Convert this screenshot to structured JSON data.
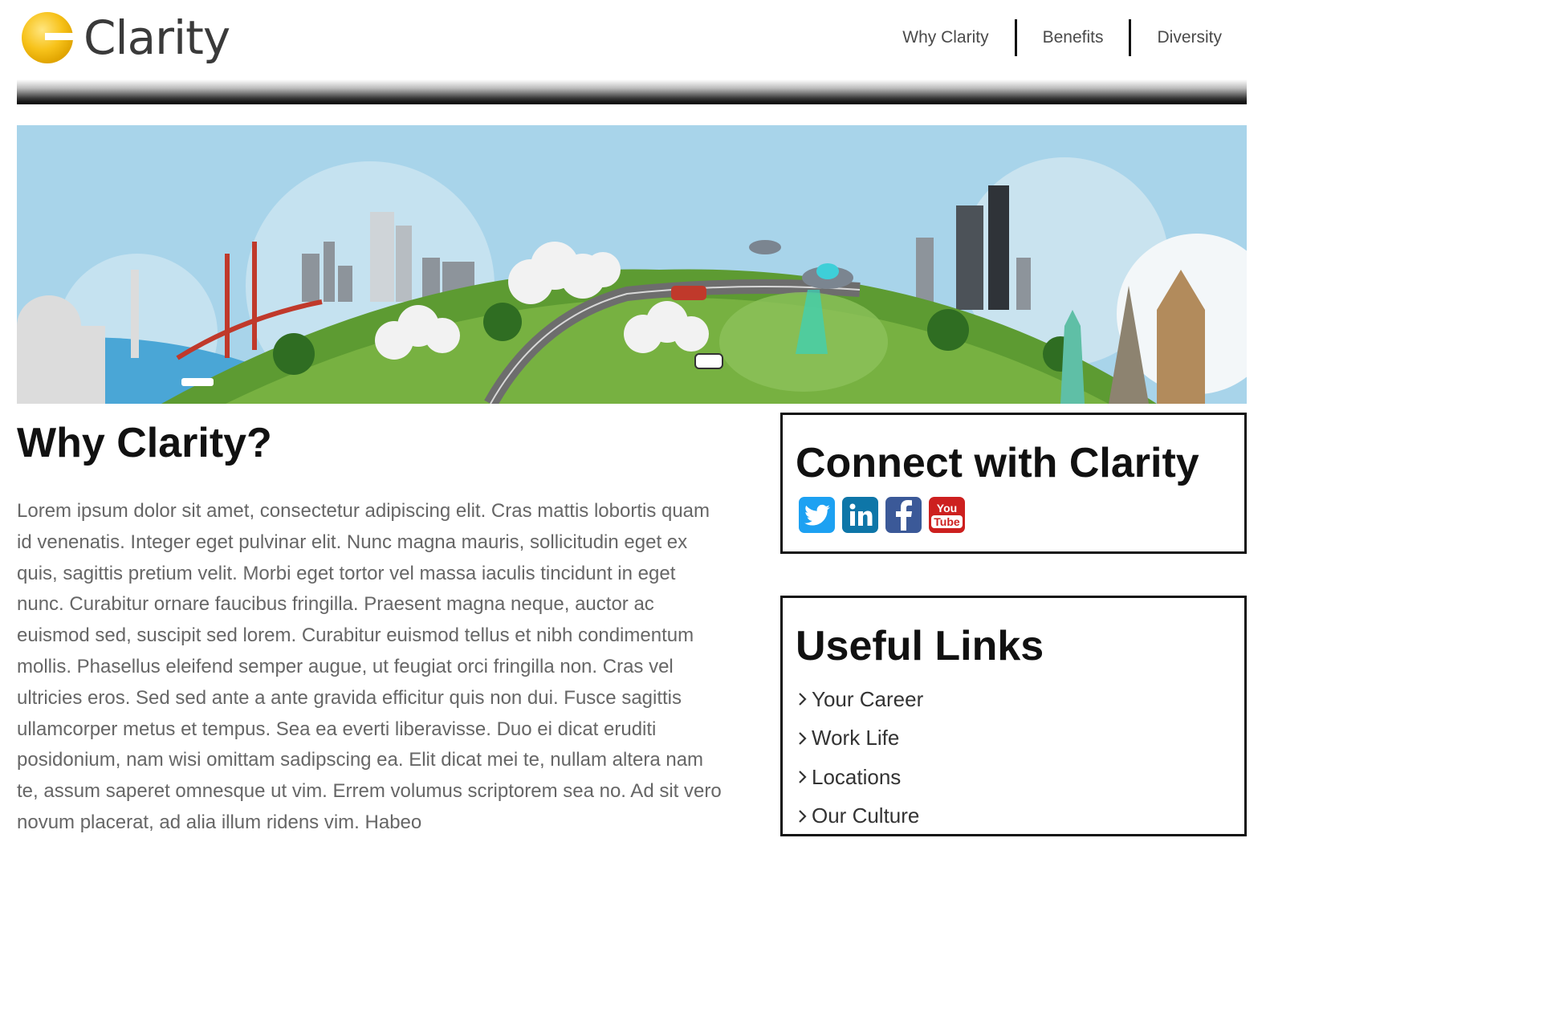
{
  "brand": {
    "name": "Clarity",
    "accent": "#f7c21a"
  },
  "nav": [
    "Why Clarity",
    "Benefits",
    "Diversity"
  ],
  "main": {
    "title": "Why Clarity?",
    "body": "Lorem ipsum dolor sit amet, consectetur adipiscing elit. Cras mattis lobortis quam id venenatis. Integer eget pulvinar elit. Nunc magna mauris, sollicitudin eget ex quis, sagittis pretium velit. Morbi eget tortor vel massa iaculis tincidunt in eget nunc. Curabitur ornare faucibus fringilla. Praesent magna neque, auctor ac euismod sed, suscipit sed lorem. Curabitur euismod tellus et nibh condimentum mollis. Phasellus eleifend semper augue, ut feugiat orci fringilla non. Cras vel ultricies eros. Sed sed ante a ante gravida efficitur quis non dui. Fusce sagittis ullamcorper metus et tempus. Sea ea everti liberavisse. Duo ei dicat eruditi posidonium, nam wisi omittam sadipscing ea. Elit dicat mei te, nullam altera nam te, assum saperet omnesque ut vim. Errem volumus scriptorem sea no. Ad sit vero novum placerat, ad alia illum ridens vim. Habeo"
  },
  "connect": {
    "title": "Connect with Clarity",
    "socials": [
      {
        "name": "twitter-icon",
        "color": "#1da1f2"
      },
      {
        "name": "linkedin-icon",
        "color": "#0e76a8"
      },
      {
        "name": "facebook-icon",
        "color": "#3b5998"
      },
      {
        "name": "youtube-icon",
        "color": "#cd201f",
        "label_top": "You",
        "label_bottom": "Tube"
      }
    ]
  },
  "useful": {
    "title": "Useful Links",
    "links": [
      "Your Career",
      "Work Life",
      "Locations",
      "Our Culture"
    ]
  }
}
